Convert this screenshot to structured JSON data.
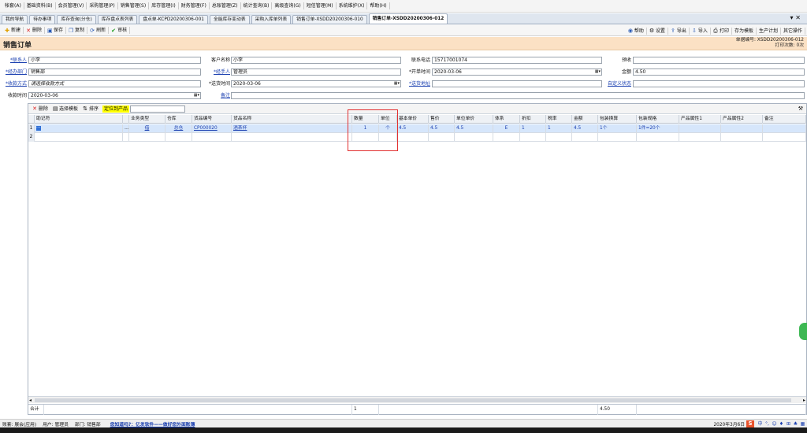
{
  "menubar": [
    "帐套(A)",
    "基础资料(B)",
    "会员管理(V)",
    "采购管理(P)",
    "销售管理(S)",
    "库存管理(I)",
    "财务管理(F)",
    "总账管理(Z)",
    "统计查询(B)",
    "高级查询(G)",
    "短信管理(M)",
    "系统维护(X)",
    "帮助(H)"
  ],
  "tabs": [
    {
      "label": "我的导航"
    },
    {
      "label": "待办事项"
    },
    {
      "label": "库存查询(分仓)"
    },
    {
      "label": "库存盘点表列表"
    },
    {
      "label": "盘点单-KCPD20200306-001"
    },
    {
      "label": "全能库存变动表"
    },
    {
      "label": "采购入库单列表"
    },
    {
      "label": "销售订单-XSDD20200306-010"
    },
    {
      "label": "销售订单-XSDD20200306-012",
      "active": true
    }
  ],
  "tab_close": "▾ ✕",
  "toolbar": {
    "new": "新建",
    "delete": "删除",
    "save": "保存",
    "copy": "复制",
    "refresh": "刷新",
    "audit": "审核",
    "help": "帮助",
    "settings": "设置",
    "export": "导出",
    "import": "导入",
    "print": "打印",
    "save_template": "存为模板",
    "production_plan": "生产计划",
    "other_ops": "其它操作"
  },
  "header": {
    "title": "销售订单",
    "doc_no_label": "单据编号: XSDD20200306-012",
    "print_count": "打印次数: 0次"
  },
  "form": {
    "contact_label": "*联系人",
    "contact_value": "小李",
    "customer_label": "客户名称",
    "customer_value": "小李",
    "phone_label": "联系电话",
    "phone_value": "15717001074",
    "prepay_label": "预收",
    "prepay_value": "",
    "dept_label": "*经办部门",
    "dept_value": "销售部",
    "handler_label": "*经手人",
    "handler_value": "管理员",
    "open_time_label": "*开单时间",
    "open_time_value": "2020-03-06",
    "amount_label": "金额",
    "amount_value": "4.50",
    "pay_label": "*收款方式",
    "pay_value": "请选择收款方式",
    "ship_time_label": "*送货时间",
    "ship_time_value": "2020-03-06",
    "ship_addr_label": "*送货地址",
    "ship_addr_value": "",
    "custom_status_label": "自定义状态",
    "custom_status_value": "",
    "receive_time_label": "收款时间",
    "receive_time_value": "2020-03-06",
    "remark_label": "备注",
    "remark_value": ""
  },
  "grid": {
    "toolbar": {
      "delete": "删除",
      "choose_template": "选择模板",
      "sort": "排序",
      "locate": "定位到产品"
    },
    "columns": [
      "",
      "助记符",
      "",
      "业务类型",
      "仓库",
      "货品编号",
      "货品名称",
      "数量",
      "单位",
      "基本单价",
      "售价",
      "单位单价",
      "体系",
      "折扣",
      "税率",
      "金额",
      "包装换算",
      "包装规格",
      "产品属性1",
      "产品属性2",
      "备注"
    ],
    "rows": [
      {
        "num": "1",
        "mnemonic": "···",
        "biz_type": "借",
        "warehouse": "总仓",
        "code": "CP000020",
        "name": "酒茶杯",
        "qty": "1",
        "unit": "个",
        "base_price": "4.5",
        "price": "4.5",
        "unit_price": "4.5",
        "system": "E",
        "discount": "1",
        "tax": "1",
        "amount": "4.5",
        "pack_convert": "1个",
        "pack_spec": "1件=20个",
        "attr1": "",
        "attr2": "",
        "remark": ""
      },
      {
        "num": "2",
        "mnemonic": "",
        "biz_type": "",
        "warehouse": "",
        "code": "",
        "name": "",
        "qty": "",
        "unit": "",
        "base_price": "",
        "price": "",
        "unit_price": "",
        "system": "",
        "discount": "",
        "tax": "",
        "amount": "",
        "pack_convert": "",
        "pack_spec": "",
        "attr1": "",
        "attr2": "",
        "remark": ""
      }
    ],
    "total": {
      "label": "合计",
      "qty": "1",
      "amount": "4.50"
    }
  },
  "statusbar": {
    "account": "账套: 展会(应用)",
    "user": "用户: 管理员",
    "dept": "部门: 销售部",
    "promo": "您知道吗?：亿发软件——做好您外面账簿",
    "date": "2020年3月6日",
    "ime": "S",
    "tray": [
      "中",
      "°,",
      "☺",
      "♦",
      "⊞",
      "♣",
      "▦"
    ]
  },
  "colors": {
    "header_bg": "#fbe1c4",
    "selected_row": "#d6e6fb",
    "highlight_box": "#e23030",
    "locate_bg": "#ffff00"
  }
}
